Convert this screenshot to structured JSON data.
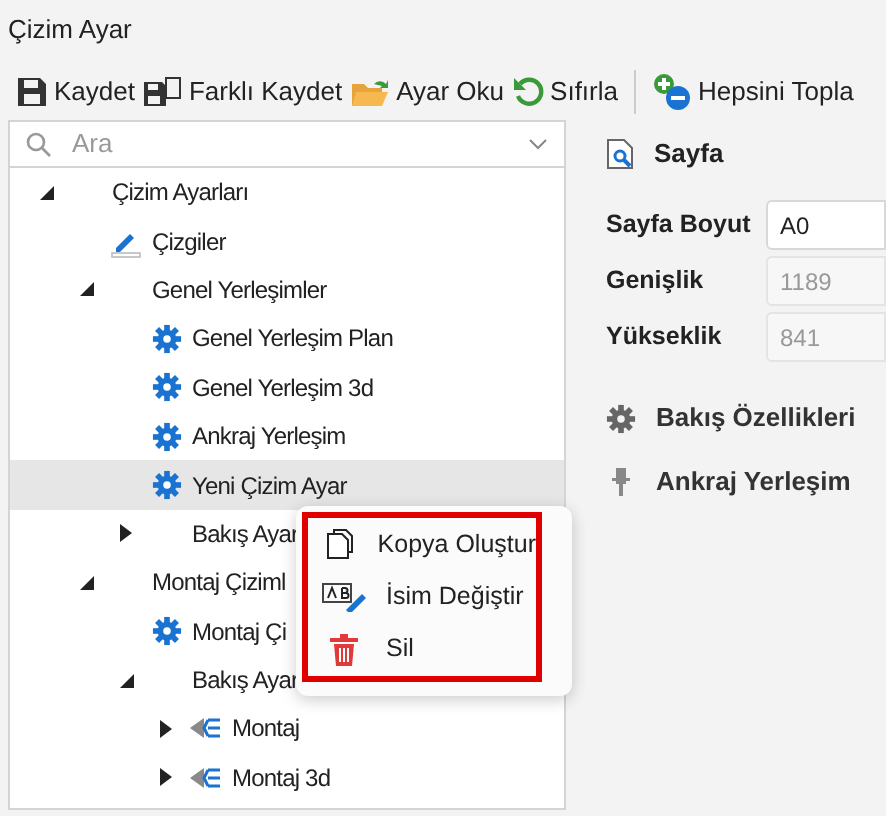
{
  "window": {
    "title": "Çizim Ayar"
  },
  "toolbar": [
    {
      "kind": "save",
      "label": "Kaydet"
    },
    {
      "kind": "save-as",
      "label": "Farklı Kaydet"
    },
    {
      "kind": "open",
      "label": "Ayar Oku"
    },
    {
      "kind": "reset",
      "label": "Sıfırla"
    },
    {
      "kind": "separator"
    },
    {
      "kind": "collapse",
      "label": "Hepsini Topla"
    }
  ],
  "search": {
    "placeholder": "Ara"
  },
  "tree": [
    {
      "label": "Çizim Ayarları",
      "expanded": true,
      "selected": false,
      "children": [
        {
          "label": "Çizgiler",
          "kind": "pencil",
          "selected": false
        },
        {
          "label": "Genel Yerleşimler",
          "expanded": true,
          "selected": false,
          "children": [
            {
              "label": "Genel Yerleşim Plan",
              "kind": "gear",
              "selected": false
            },
            {
              "label": "Genel Yerleşim 3d",
              "kind": "gear",
              "selected": false
            },
            {
              "label": "Ankraj Yerleşim",
              "kind": "gear",
              "selected": false
            },
            {
              "label": "Yeni Çizim Ayar",
              "kind": "gear",
              "selected": true
            },
            {
              "label": "Bakış Ayar",
              "expanded": false,
              "selected": false
            }
          ]
        },
        {
          "label": "Montaj Çiziml",
          "expanded": true,
          "selected": false,
          "children": [
            {
              "label": "Montaj Çi",
              "kind": "gear",
              "selected": false
            },
            {
              "label": "Bakış Ayar",
              "expanded": true,
              "selected": false,
              "children": [
                {
                  "label": "Montaj",
                  "kind": "view",
                  "expanded": false,
                  "selected": false
                },
                {
                  "label": "Montaj 3d",
                  "kind": "view",
                  "expanded": false,
                  "selected": false
                }
              ]
            }
          ]
        }
      ]
    }
  ],
  "context_menu": [
    {
      "kind": "copy",
      "label": "Kopya Oluştur"
    },
    {
      "kind": "rename",
      "label": "İsim Değiştir"
    },
    {
      "kind": "delete",
      "label": "Sil"
    }
  ],
  "properties": {
    "section": "Sayfa",
    "fields": [
      {
        "label": "Sayfa Boyut",
        "value": "A0",
        "disabled": false
      },
      {
        "label": "Genişlik",
        "value": "1189",
        "disabled": true
      },
      {
        "label": "Yükseklik",
        "value": "841",
        "disabled": true
      }
    ],
    "groups": [
      {
        "kind": "gear",
        "label": "Bakış Özellikleri"
      },
      {
        "kind": "anchor",
        "label": "Ankraj Yerleşim"
      }
    ]
  }
}
